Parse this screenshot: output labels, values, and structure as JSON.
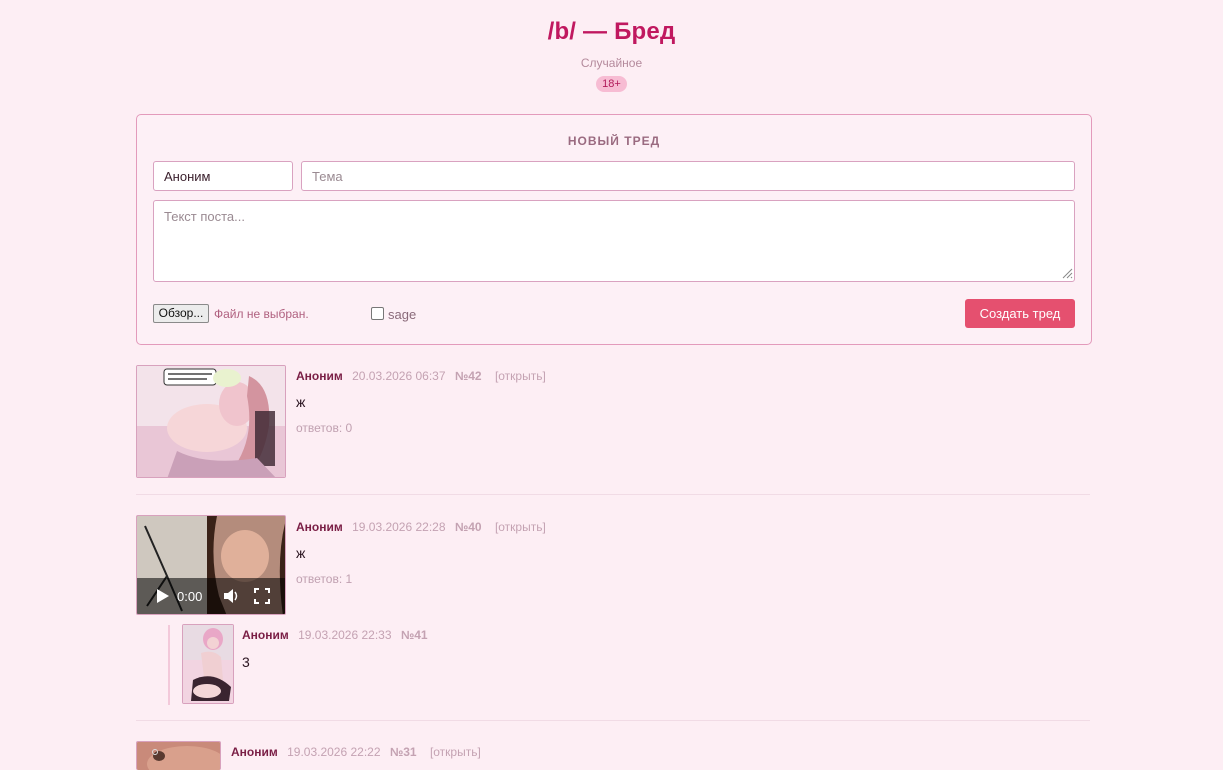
{
  "board": {
    "title": "/b/ — Бред",
    "subtitle": "Случайное",
    "badge": "18+"
  },
  "form": {
    "heading": "НОВЫЙ ТРЕД",
    "name_value": "Аноним",
    "subject_placeholder": "Тема",
    "text_placeholder": "Текст поста...",
    "file_button": "Обзор...",
    "file_status": "Файл не выбран.",
    "sage_label": "sage",
    "submit_label": "Создать тред"
  },
  "threads": [
    {
      "author": "Аноним",
      "date": "20.03.2026 06:37",
      "number": "№42",
      "open_label": "[открыть]",
      "text": "ж",
      "replies": "ответов: 0"
    },
    {
      "author": "Аноним",
      "date": "19.03.2026 22:28",
      "number": "№40",
      "open_label": "[открыть]",
      "text": "ж",
      "replies": "ответов: 1",
      "video_time": "0:00",
      "reply": {
        "author": "Аноним",
        "date": "19.03.2026 22:33",
        "number": "№41",
        "text": "3"
      }
    },
    {
      "author": "Аноним",
      "date": "19.03.2026 22:22",
      "number": "№31",
      "open_label": "[открыть]"
    }
  ],
  "colors": {
    "background": "#fdeef4",
    "accent": "#c0185f",
    "button": "#e5506f"
  }
}
